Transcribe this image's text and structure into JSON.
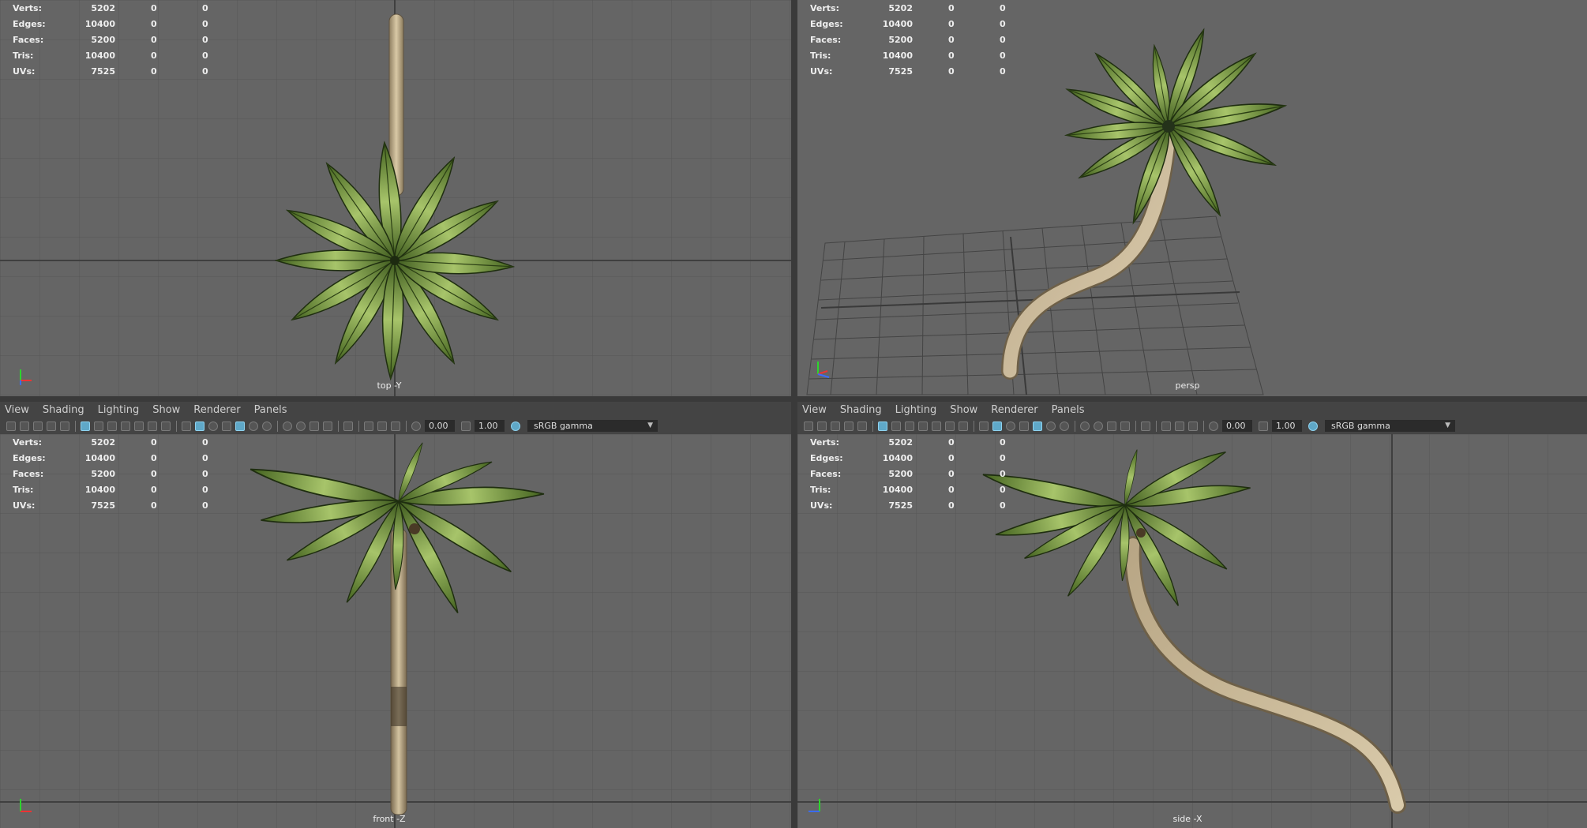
{
  "stats": [
    {
      "label": "Verts:",
      "v1": "5202",
      "v2": "0",
      "v3": "0"
    },
    {
      "label": "Edges:",
      "v1": "10400",
      "v2": "0",
      "v3": "0"
    },
    {
      "label": "Faces:",
      "v1": "5200",
      "v2": "0",
      "v3": "0"
    },
    {
      "label": "Tris:",
      "v1": "10400",
      "v2": "0",
      "v3": "0"
    },
    {
      "label": "UVs:",
      "v1": "7525",
      "v2": "0",
      "v3": "0"
    }
  ],
  "viewports": {
    "top": {
      "label": "top -Y"
    },
    "persp": {
      "label": "persp"
    },
    "front": {
      "label": "front -Z"
    },
    "side": {
      "label": "side -X"
    }
  },
  "panel_menu": [
    "View",
    "Shading",
    "Lighting",
    "Show",
    "Renderer",
    "Panels"
  ],
  "toolbar": {
    "exposure": "0.00",
    "gamma": "1.00",
    "color_space": "sRGB gamma"
  },
  "axis_labels": {
    "x": "x",
    "y": "y",
    "z": "z"
  },
  "colors": {
    "viewport_bg": "#656565",
    "grid": "#555555",
    "axis_y": "#2dd42d",
    "axis_x": "#e33",
    "axis_z": "#3a6cff",
    "accent": "#5fa8c8"
  }
}
